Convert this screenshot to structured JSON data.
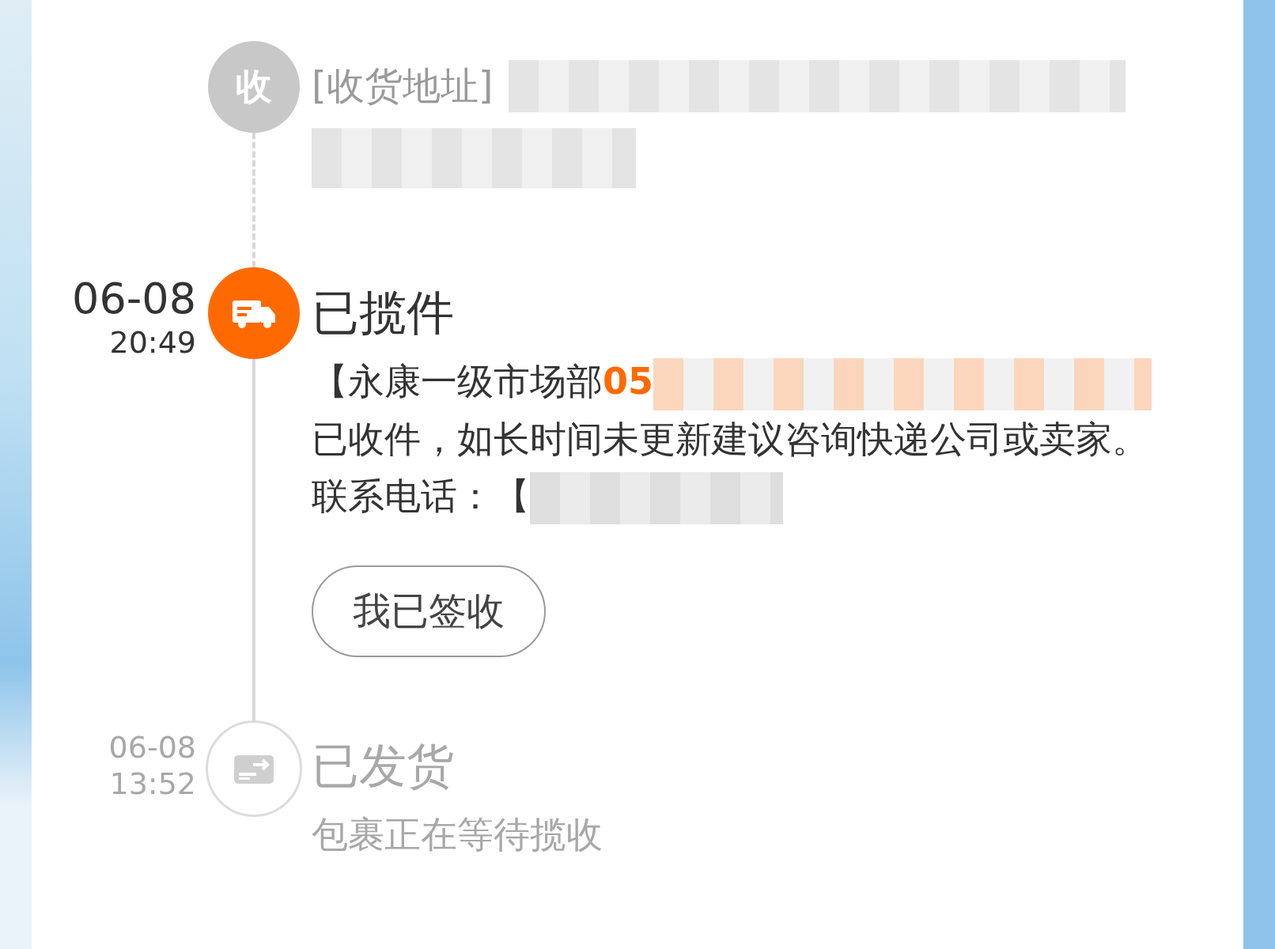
{
  "address": {
    "icon_label": "收",
    "text": "[收货地址]"
  },
  "events": [
    {
      "kind": "current",
      "date": "06-08",
      "time": "20:49",
      "title": "已揽件",
      "description": [
        {
          "kind": "text",
          "text": "【永康一级市场部"
        },
        {
          "kind": "highlight",
          "text": "05"
        },
        {
          "kind": "redacted"
        },
        {
          "kind": "text",
          "text": "已收件，如长时间未更新建议咨询快递公司或卖家。联系电话：【"
        },
        {
          "kind": "redacted"
        }
      ],
      "action": "我已签收"
    },
    {
      "kind": "past",
      "date": "06-08",
      "time": "13:52",
      "title": "已发货",
      "description": [
        {
          "kind": "text",
          "text": "包裹正在等待揽收"
        }
      ]
    }
  ]
}
